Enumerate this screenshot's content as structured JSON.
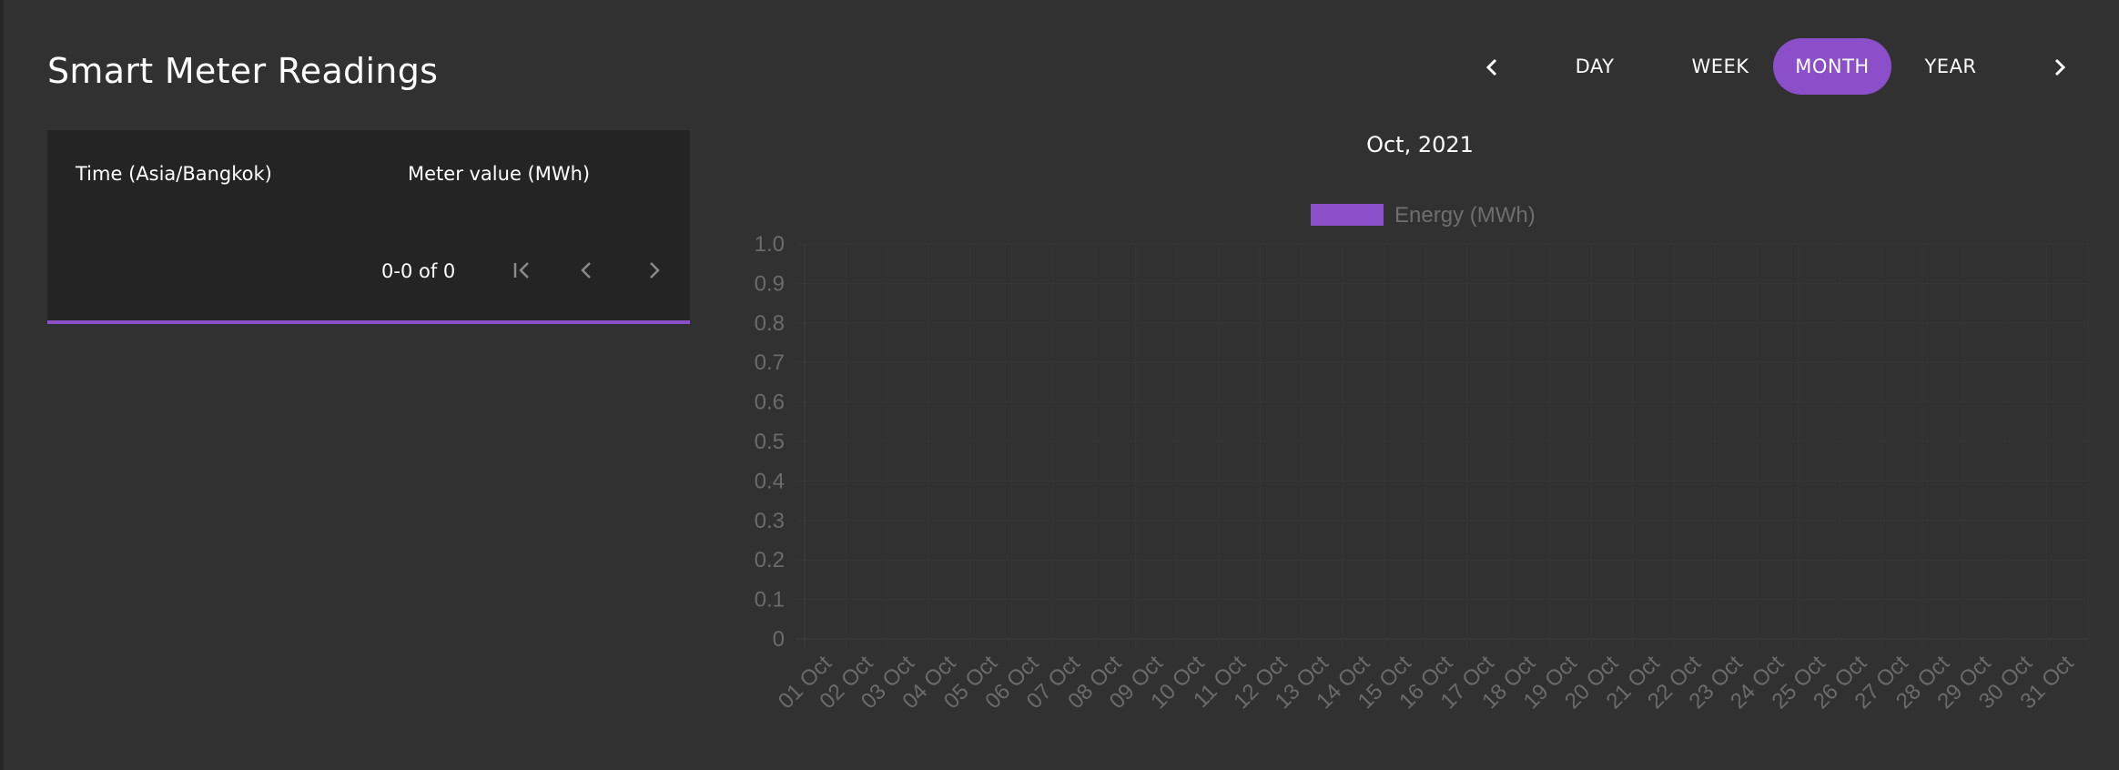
{
  "page": {
    "title": "Smart Meter Readings"
  },
  "range_selector": {
    "prev_icon": "chevron-left-icon",
    "next_icon": "chevron-right-icon",
    "options": [
      "DAY",
      "WEEK",
      "MONTH",
      "YEAR"
    ],
    "selected": "MONTH",
    "accent_color": "#8a4fc9"
  },
  "table": {
    "columns": [
      "Time (Asia/Bangkok)",
      "Meter value (MWh)"
    ],
    "rows": [],
    "pagination": {
      "range_text": "0-0 of 0",
      "first_icon": "first-page-icon",
      "prev_icon": "chevron-left-icon",
      "next_icon": "chevron-right-icon"
    }
  },
  "chart_data": {
    "type": "bar",
    "title": "Oct, 2021",
    "categories": [
      "01 Oct",
      "02 Oct",
      "03 Oct",
      "04 Oct",
      "05 Oct",
      "06 Oct",
      "07 Oct",
      "08 Oct",
      "09 Oct",
      "10 Oct",
      "11 Oct",
      "12 Oct",
      "13 Oct",
      "14 Oct",
      "15 Oct",
      "16 Oct",
      "17 Oct",
      "18 Oct",
      "19 Oct",
      "20 Oct",
      "21 Oct",
      "22 Oct",
      "23 Oct",
      "24 Oct",
      "25 Oct",
      "26 Oct",
      "27 Oct",
      "28 Oct",
      "29 Oct",
      "30 Oct",
      "31 Oct"
    ],
    "series": [
      {
        "name": "Energy (MWh)",
        "color": "#8a4fc9",
        "values": []
      }
    ],
    "yticks": [
      "0",
      "0.1",
      "0.2",
      "0.3",
      "0.4",
      "0.5",
      "0.6",
      "0.7",
      "0.8",
      "0.9",
      "1.0"
    ],
    "ylim": [
      0,
      1.0
    ],
    "grid": true,
    "legend_position": "top-center"
  }
}
